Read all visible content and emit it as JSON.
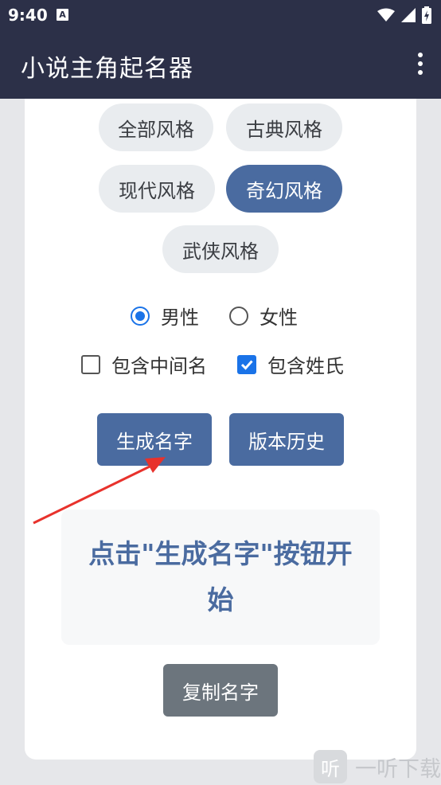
{
  "status_bar": {
    "time": "9:40",
    "notification_icon": "a-notification-icon",
    "icons": [
      "wifi-icon",
      "signal-icon",
      "battery-charging-icon"
    ]
  },
  "app_bar": {
    "title": "小说主角起名器",
    "menu_icon": "overflow-menu-icon"
  },
  "styles": {
    "items": [
      {
        "label": "全部风格",
        "selected": false
      },
      {
        "label": "古典风格",
        "selected": false
      },
      {
        "label": "现代风格",
        "selected": false
      },
      {
        "label": "奇幻风格",
        "selected": true
      },
      {
        "label": "武侠风格",
        "selected": false
      }
    ]
  },
  "gender": {
    "options": [
      {
        "label": "男性",
        "checked": true
      },
      {
        "label": "女性",
        "checked": false
      }
    ]
  },
  "options": {
    "items": [
      {
        "label": "包含中间名",
        "checked": false
      },
      {
        "label": "包含姓氏",
        "checked": true
      }
    ]
  },
  "actions": {
    "generate_label": "生成名字",
    "history_label": "版本历史",
    "copy_label": "复制名字"
  },
  "result": {
    "text": "点击\"生成名字\"按钮开始"
  },
  "watermark": {
    "logo": "听",
    "text": "一听下载"
  },
  "colors": {
    "app_bar": "#2c3048",
    "accent": "#4a6ba0",
    "checkbox": "#1a73e8",
    "copy_button": "#6c757d",
    "annotation_arrow": "#e8322c"
  }
}
